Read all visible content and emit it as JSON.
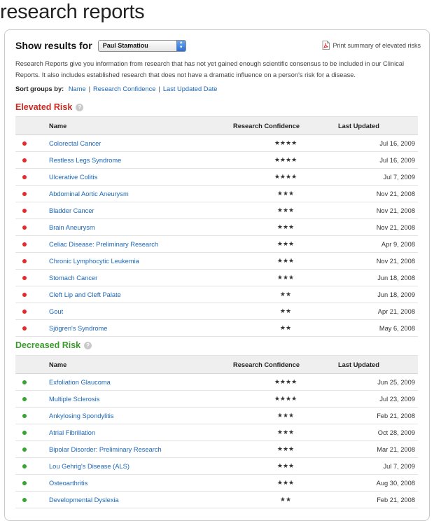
{
  "page_title": "research reports",
  "header": {
    "show_results_label": "Show results for",
    "selected_user": "Paul Stamatiou",
    "print_link": "Print summary of elevated risks"
  },
  "intro_text": "Research Reports give you information from research that has not yet gained enough scientific consensus to be included in our Clinical Reports. It also includes established research that does not have a dramatic influence on a person's risk for a disease.",
  "sort": {
    "label": "Sort groups by:",
    "options": [
      "Name",
      "Research Confidence",
      "Last Updated Date"
    ]
  },
  "columns": {
    "name": "Name",
    "confidence": "Research Confidence",
    "updated": "Last Updated"
  },
  "elevated": {
    "title": "Elevated Risk",
    "color": "#cc2a22",
    "rows": [
      {
        "name": "Colorectal Cancer",
        "stars": "★★★★",
        "updated": "Jul 16, 2009"
      },
      {
        "name": "Restless Legs Syndrome",
        "stars": "★★★★",
        "updated": "Jul 16, 2009"
      },
      {
        "name": "Ulcerative Colitis",
        "stars": "★★★★",
        "updated": "Jul 7, 2009"
      },
      {
        "name": "Abdominal Aortic Aneurysm",
        "stars": "★★★",
        "updated": "Nov 21, 2008"
      },
      {
        "name": "Bladder Cancer",
        "stars": "★★★",
        "updated": "Nov 21, 2008"
      },
      {
        "name": "Brain Aneurysm",
        "stars": "★★★",
        "updated": "Nov 21, 2008"
      },
      {
        "name": "Celiac Disease: Preliminary Research",
        "stars": "★★★",
        "updated": "Apr 9, 2008"
      },
      {
        "name": "Chronic Lymphocytic Leukemia",
        "stars": "★★★",
        "updated": "Nov 21, 2008"
      },
      {
        "name": "Stomach Cancer",
        "stars": "★★★",
        "updated": "Jun 18, 2008"
      },
      {
        "name": "Cleft Lip and Cleft Palate",
        "stars": "★★",
        "updated": "Jun 18, 2009"
      },
      {
        "name": "Gout",
        "stars": "★★",
        "updated": "Apr 21, 2008"
      },
      {
        "name": "Sjögren's Syndrome",
        "stars": "★★",
        "updated": "May 6, 2008"
      }
    ]
  },
  "decreased": {
    "title": "Decreased Risk",
    "color": "#3a9a2c",
    "rows": [
      {
        "name": "Exfoliation Glaucoma",
        "stars": "★★★★",
        "updated": "Jun 25, 2009"
      },
      {
        "name": "Multiple Sclerosis",
        "stars": "★★★★",
        "updated": "Jul 23, 2009"
      },
      {
        "name": "Ankylosing Spondylitis",
        "stars": "★★★",
        "updated": "Feb 21, 2008"
      },
      {
        "name": "Atrial Fibrillation",
        "stars": "★★★",
        "updated": "Oct 28, 2009"
      },
      {
        "name": "Bipolar Disorder: Preliminary Research",
        "stars": "★★★",
        "updated": "Mar 21, 2008"
      },
      {
        "name": "Lou Gehrig's Disease (ALS)",
        "stars": "★★★",
        "updated": "Jul 7, 2009"
      },
      {
        "name": "Osteoarthritis",
        "stars": "★★★",
        "updated": "Aug 30, 2008"
      },
      {
        "name": "Developmental Dyslexia",
        "stars": "★★",
        "updated": "Feb 21, 2008"
      }
    ]
  }
}
